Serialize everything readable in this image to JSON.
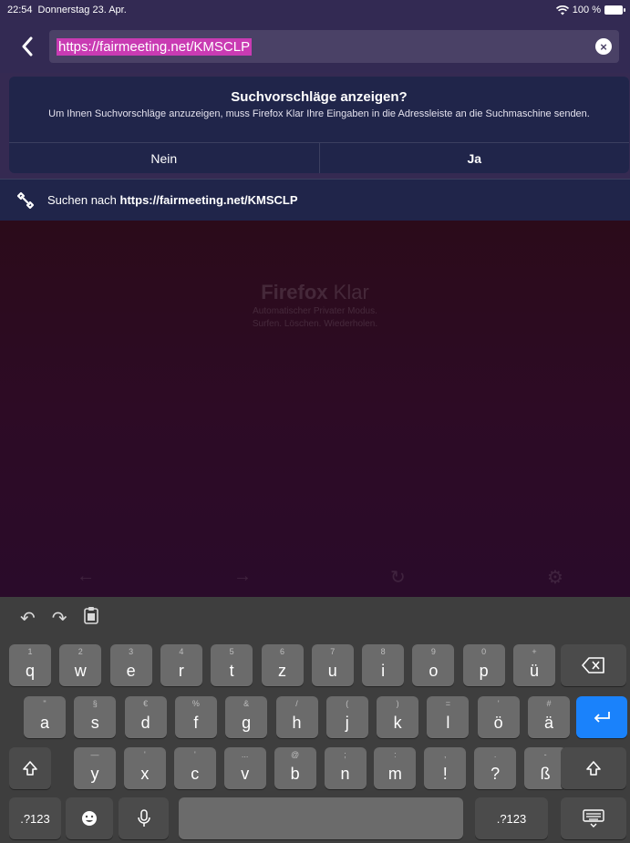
{
  "status": {
    "time": "22:54",
    "date": "Donnerstag 23. Apr.",
    "battery": "100 %"
  },
  "urlbar": {
    "url": "https://fairmeeting.net/KMSCLP"
  },
  "suggest": {
    "title": "Suchvorschläge anzeigen?",
    "text": "Um Ihnen Suchvorschläge anzuzeigen, muss Firefox Klar Ihre Eingaben in die Adressleiste an die Suchmaschine senden.",
    "no": "Nein",
    "yes": "Ja"
  },
  "search_row": {
    "prefix": "Suchen nach",
    "query": "https://fairmeeting.net/KMSCLP"
  },
  "home": {
    "brand_bold": "Firefox",
    "brand_light": "Klar",
    "tag1": "Automatischer Privater Modus.",
    "tag2": "Surfen. Löschen. Wiederholen."
  },
  "keyboard": {
    "row1": [
      {
        "k": "q",
        "h": "1"
      },
      {
        "k": "w",
        "h": "2"
      },
      {
        "k": "e",
        "h": "3"
      },
      {
        "k": "r",
        "h": "4"
      },
      {
        "k": "t",
        "h": "5"
      },
      {
        "k": "z",
        "h": "6"
      },
      {
        "k": "u",
        "h": "7"
      },
      {
        "k": "i",
        "h": "8"
      },
      {
        "k": "o",
        "h": "9"
      },
      {
        "k": "p",
        "h": "0"
      },
      {
        "k": "ü",
        "h": "+"
      }
    ],
    "row2": [
      {
        "k": "a",
        "h": "\""
      },
      {
        "k": "s",
        "h": "§"
      },
      {
        "k": "d",
        "h": "€"
      },
      {
        "k": "f",
        "h": "%"
      },
      {
        "k": "g",
        "h": "&"
      },
      {
        "k": "h",
        "h": "/"
      },
      {
        "k": "j",
        "h": "("
      },
      {
        "k": "k",
        "h": ")"
      },
      {
        "k": "l",
        "h": "="
      },
      {
        "k": "ö",
        "h": "'"
      },
      {
        "k": "ä",
        "h": "#"
      }
    ],
    "row3": [
      {
        "k": "y",
        "h": "—"
      },
      {
        "k": "x",
        "h": "'"
      },
      {
        "k": "c",
        "h": "'"
      },
      {
        "k": "v",
        "h": "..."
      },
      {
        "k": "b",
        "h": "@"
      },
      {
        "k": "n",
        "h": ";"
      },
      {
        "k": "m",
        "h": ":"
      },
      {
        "k": "!",
        "h": ","
      },
      {
        "k": "?",
        "h": "."
      },
      {
        "k": "ß",
        "h": "-"
      }
    ],
    "numbers_label": ".?123"
  }
}
